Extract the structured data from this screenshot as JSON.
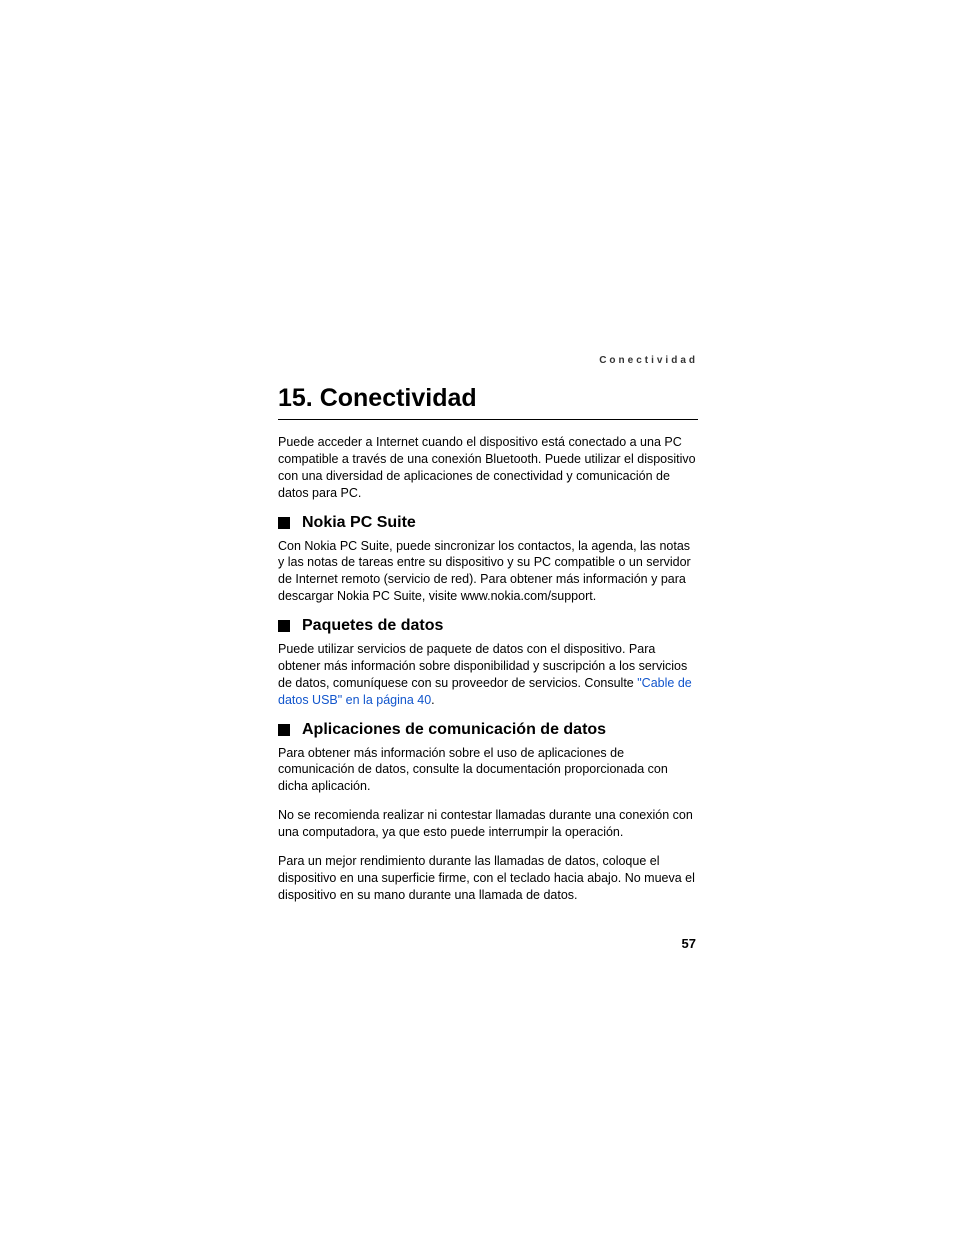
{
  "runningHeader": "Conectividad",
  "chapterTitle": "15.  Conectividad",
  "introText": "Puede acceder a Internet cuando el dispositivo está conectado a una PC compatible a través de una conexión Bluetooth. Puede utilizar el dispositivo con una diversidad de aplicaciones de conectividad y comunicación de datos para PC.",
  "sections": [
    {
      "title": "Nokia PC Suite",
      "paragraphs": [
        {
          "text": "Con Nokia PC Suite, puede sincronizar los contactos, la agenda, las notas y las notas de tareas entre su dispositivo y su PC compatible o un servidor de Internet remoto (servicio de red). Para obtener más información y para descargar Nokia PC Suite, visite www.nokia.com/support."
        }
      ]
    },
    {
      "title": "Paquetes de datos",
      "paragraphs": [
        {
          "text": "Puede utilizar servicios de paquete de datos con el dispositivo. Para obtener más información sobre disponibilidad y suscripción a los servicios de datos, comuníquese con su proveedor de servicios. Consulte ",
          "link": "\"Cable de datos USB\" en la página 40",
          "afterLink": "."
        }
      ]
    },
    {
      "title": "Aplicaciones de comunicación de datos",
      "paragraphs": [
        {
          "text": "Para obtener más información sobre el uso de aplicaciones de comunicación de datos, consulte la documentación proporcionada con dicha aplicación."
        },
        {
          "text": "No se recomienda realizar ni contestar llamadas durante una conexión con una computadora, ya que esto puede interrumpir la operación."
        },
        {
          "text": "Para un mejor rendimiento durante las llamadas de datos, coloque el dispositivo en una superficie firme, con el teclado hacia abajo. No mueva el dispositivo en su mano durante una llamada de datos."
        }
      ]
    }
  ],
  "pageNumber": "57"
}
